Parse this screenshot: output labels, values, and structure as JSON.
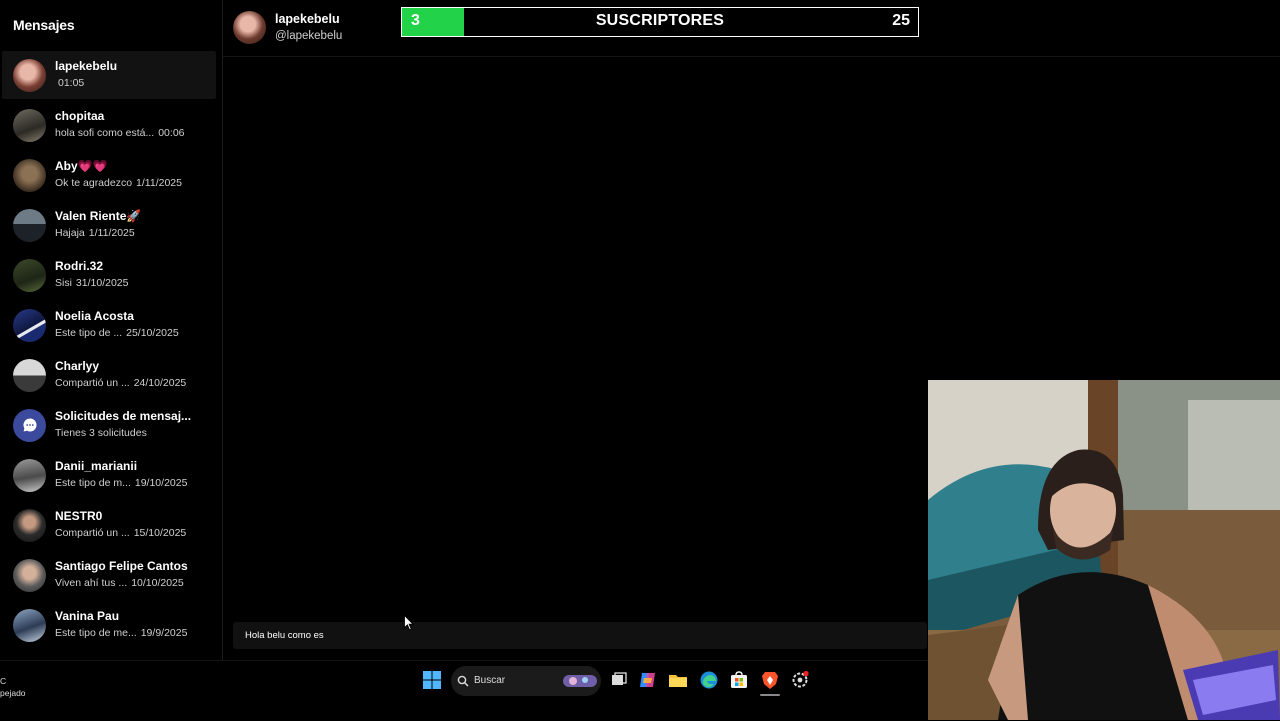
{
  "sidebar": {
    "title": "Mensajes",
    "conversations": [
      {
        "name": "lapekebelu",
        "preview": "",
        "time": "01:05",
        "active": true
      },
      {
        "name": "chopitaa",
        "preview": "hola sofi como está...",
        "time": "00:06"
      },
      {
        "name": "Aby💗💗",
        "preview": "Ok te agradezco",
        "time": "1/11/2025"
      },
      {
        "name": "Valen Riente🚀",
        "preview": "Hajaja",
        "time": "1/11/2025"
      },
      {
        "name": "Rodri.32",
        "preview": "Sisi",
        "time": "31/10/2025"
      },
      {
        "name": "Noelia Acosta",
        "preview": "Este tipo de ...",
        "time": "25/10/2025"
      },
      {
        "name": "Charlyy",
        "preview": "Compartió un ...",
        "time": "24/10/2025"
      },
      {
        "name": "Solicitudes de mensaj...",
        "preview": "Tienes 3 solicitudes",
        "time": ""
      },
      {
        "name": "Danii_marianii",
        "preview": "Este tipo de m...",
        "time": "19/10/2025"
      },
      {
        "name": "NESTR0",
        "preview": "Compartió un ...",
        "time": "15/10/2025"
      },
      {
        "name": "Santiago Felipe Cantos",
        "preview": "Viven ahí tus ...",
        "time": "10/10/2025"
      },
      {
        "name": "Vanina Pau",
        "preview": "Este tipo de me...",
        "time": "19/9/2025"
      }
    ]
  },
  "chat": {
    "name": "lapekebelu",
    "handle": "@lapekebelu",
    "input_value": "Hola belu como es"
  },
  "subscriber_goal": {
    "current": "3",
    "label": "SUSCRIPTORES",
    "goal": "25",
    "progress_fraction": 0.12,
    "fill_color": "#22d34a"
  },
  "taskbar": {
    "weather_line1": "C",
    "weather_line2": "pejado",
    "search_placeholder": "Buscar",
    "icons": [
      "windows-start-icon",
      "search-icon",
      "task-view-icon",
      "copilot-icon",
      "file-explorer-icon",
      "edge-icon",
      "store-icon",
      "brave-icon",
      "settings-icon"
    ]
  }
}
